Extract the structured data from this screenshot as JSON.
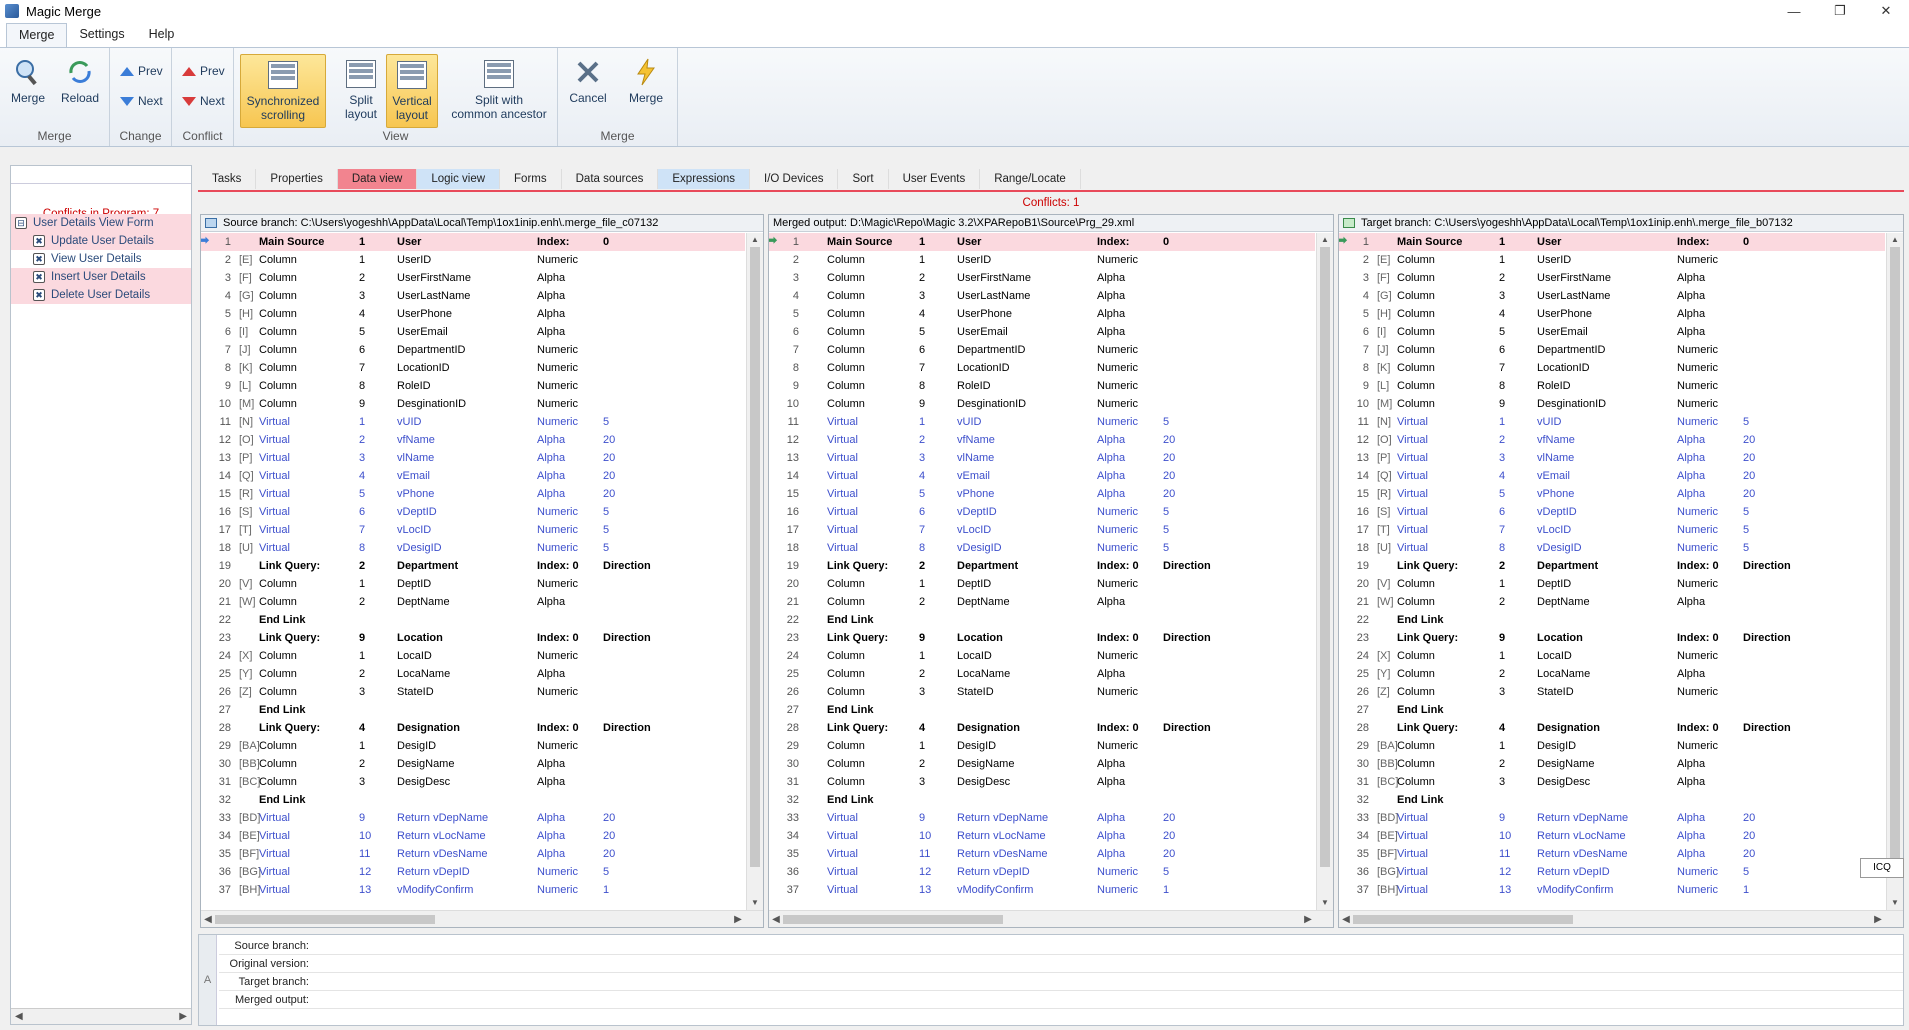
{
  "window": {
    "title": "Magic Merge"
  },
  "menu_tabs": [
    "Merge",
    "Settings",
    "Help"
  ],
  "ribbon": {
    "merge_group": {
      "label": "Merge",
      "merge": "Merge",
      "reload": "Reload"
    },
    "change_group": {
      "label": "Change",
      "prev": "Prev",
      "next": "Next"
    },
    "conflict_group": {
      "label": "Conflict",
      "prev": "Prev",
      "next": "Next"
    },
    "view_group": {
      "label": "View",
      "sync_line1": "Synchronized",
      "sync_line2": "scrolling",
      "split_line1": "Split",
      "split_line2": "layout",
      "vertical_line1": "Vertical",
      "vertical_line2": "layout",
      "ancestor_line1": "Split with",
      "ancestor_line2": "common ancestor"
    },
    "merge2_group": {
      "label": "Merge",
      "cancel": "Cancel",
      "merge": "Merge"
    }
  },
  "left_panel": {
    "conflicts_label": "Conflicts in Program: 7",
    "tree": [
      "User Details View Form",
      "Update User Details",
      "View User Details",
      "Insert User Details",
      "Delete User Details"
    ]
  },
  "tabs": [
    "Tasks",
    "Properties",
    "Data view",
    "Logic view",
    "Forms",
    "Data sources",
    "Expressions",
    "I/O Devices",
    "Sort",
    "User Events",
    "Range/Locate"
  ],
  "conflicts_label": "Conflicts: 1",
  "panes": {
    "source": "Source branch:  C:\\Users\\yogeshh\\AppData\\Local\\Temp\\1ox1inip.enh\\.merge_file_c07132",
    "merged": "Merged output:  D:\\Magic\\Repo\\Magic 3.2\\XPARepoB1\\Source\\Prg_29.xml",
    "target": "Target branch:  C:\\Users\\yogeshh\\AppData\\Local\\Temp\\1ox1inip.enh\\.merge_file_b07132"
  },
  "rows": [
    {
      "n": "1",
      "v": "",
      "t": "Main Source",
      "i": "1",
      "name": "User",
      "type": "Index:",
      "sz": "0",
      "kind": "bold"
    },
    {
      "n": "2",
      "v": "[E]",
      "t": "Column",
      "i": "1",
      "name": "UserID",
      "type": "Numeric",
      "sz": "",
      "kind": "col"
    },
    {
      "n": "3",
      "v": "[F]",
      "t": "Column",
      "i": "2",
      "name": "UserFirstName",
      "type": "Alpha",
      "sz": "",
      "kind": "col"
    },
    {
      "n": "4",
      "v": "[G]",
      "t": "Column",
      "i": "3",
      "name": "UserLastName",
      "type": "Alpha",
      "sz": "",
      "kind": "col"
    },
    {
      "n": "5",
      "v": "[H]",
      "t": "Column",
      "i": "4",
      "name": "UserPhone",
      "type": "Alpha",
      "sz": "",
      "kind": "col"
    },
    {
      "n": "6",
      "v": "[I]",
      "t": "Column",
      "i": "5",
      "name": "UserEmail",
      "type": "Alpha",
      "sz": "",
      "kind": "col"
    },
    {
      "n": "7",
      "v": "[J]",
      "t": "Column",
      "i": "6",
      "name": "DepartmentID",
      "type": "Numeric",
      "sz": "",
      "kind": "col"
    },
    {
      "n": "8",
      "v": "[K]",
      "t": "Column",
      "i": "7",
      "name": "LocationID",
      "type": "Numeric",
      "sz": "",
      "kind": "col"
    },
    {
      "n": "9",
      "v": "[L]",
      "t": "Column",
      "i": "8",
      "name": "RoleID",
      "type": "Numeric",
      "sz": "",
      "kind": "col"
    },
    {
      "n": "10",
      "v": "[M]",
      "t": "Column",
      "i": "9",
      "name": "DesginationID",
      "type": "Numeric",
      "sz": "",
      "kind": "col"
    },
    {
      "n": "11",
      "v": "[N]",
      "t": "Virtual",
      "i": "1",
      "name": "vUID",
      "type": "Numeric",
      "sz": "5",
      "kind": "virt"
    },
    {
      "n": "12",
      "v": "[O]",
      "t": "Virtual",
      "i": "2",
      "name": "vfName",
      "type": "Alpha",
      "sz": "20",
      "kind": "virt"
    },
    {
      "n": "13",
      "v": "[P]",
      "t": "Virtual",
      "i": "3",
      "name": "vlName",
      "type": "Alpha",
      "sz": "20",
      "kind": "virt"
    },
    {
      "n": "14",
      "v": "[Q]",
      "t": "Virtual",
      "i": "4",
      "name": "vEmail",
      "type": "Alpha",
      "sz": "20",
      "kind": "virt"
    },
    {
      "n": "15",
      "v": "[R]",
      "t": "Virtual",
      "i": "5",
      "name": "vPhone",
      "type": "Alpha",
      "sz": "20",
      "kind": "virt"
    },
    {
      "n": "16",
      "v": "[S]",
      "t": "Virtual",
      "i": "6",
      "name": "vDeptID",
      "type": "Numeric",
      "sz": "5",
      "kind": "virt"
    },
    {
      "n": "17",
      "v": "[T]",
      "t": "Virtual",
      "i": "7",
      "name": "vLocID",
      "type": "Numeric",
      "sz": "5",
      "kind": "virt"
    },
    {
      "n": "18",
      "v": "[U]",
      "t": "Virtual",
      "i": "8",
      "name": "vDesigID",
      "type": "Numeric",
      "sz": "5",
      "kind": "virt"
    },
    {
      "n": "19",
      "v": "",
      "t": "Link Query:",
      "i": "2",
      "name": "Department",
      "type": "Index: 0",
      "sz": "Direction",
      "kind": "bold"
    },
    {
      "n": "20",
      "v": "[V]",
      "t": "Column",
      "i": "1",
      "name": "DeptID",
      "type": "Numeric",
      "sz": "",
      "kind": "col"
    },
    {
      "n": "21",
      "v": "[W]",
      "t": "Column",
      "i": "2",
      "name": "DeptName",
      "type": "Alpha",
      "sz": "",
      "kind": "col"
    },
    {
      "n": "22",
      "v": "",
      "t": "End Link",
      "i": "",
      "name": "",
      "type": "",
      "sz": "",
      "kind": "bold"
    },
    {
      "n": "23",
      "v": "",
      "t": "Link Query:",
      "i": "9",
      "name": "Location",
      "type": "Index: 0",
      "sz": "Direction",
      "kind": "bold"
    },
    {
      "n": "24",
      "v": "[X]",
      "t": "Column",
      "i": "1",
      "name": "LocaID",
      "type": "Numeric",
      "sz": "",
      "kind": "col"
    },
    {
      "n": "25",
      "v": "[Y]",
      "t": "Column",
      "i": "2",
      "name": "LocaName",
      "type": "Alpha",
      "sz": "",
      "kind": "col"
    },
    {
      "n": "26",
      "v": "[Z]",
      "t": "Column",
      "i": "3",
      "name": "StateID",
      "type": "Numeric",
      "sz": "",
      "kind": "col"
    },
    {
      "n": "27",
      "v": "",
      "t": "End Link",
      "i": "",
      "name": "",
      "type": "",
      "sz": "",
      "kind": "bold"
    },
    {
      "n": "28",
      "v": "",
      "t": "Link Query:",
      "i": "4",
      "name": "Designation",
      "type": "Index: 0",
      "sz": "Direction",
      "kind": "bold"
    },
    {
      "n": "29",
      "v": "[BA]",
      "t": "Column",
      "i": "1",
      "name": "DesigID",
      "type": "Numeric",
      "sz": "",
      "kind": "col"
    },
    {
      "n": "30",
      "v": "[BB]",
      "t": "Column",
      "i": "2",
      "name": "DesigName",
      "type": "Alpha",
      "sz": "",
      "kind": "col"
    },
    {
      "n": "31",
      "v": "[BC]",
      "t": "Column",
      "i": "3",
      "name": "DesigDesc",
      "type": "Alpha",
      "sz": "",
      "kind": "col"
    },
    {
      "n": "32",
      "v": "",
      "t": "End Link",
      "i": "",
      "name": "",
      "type": "",
      "sz": "",
      "kind": "bold"
    },
    {
      "n": "33",
      "v": "[BD]",
      "t": "Virtual",
      "i": "9",
      "name": "Return vDepName",
      "type": "Alpha",
      "sz": "20",
      "kind": "virt"
    },
    {
      "n": "34",
      "v": "[BE]",
      "t": "Virtual",
      "i": "10",
      "name": "Return vLocName",
      "type": "Alpha",
      "sz": "20",
      "kind": "virt"
    },
    {
      "n": "35",
      "v": "[BF]",
      "t": "Virtual",
      "i": "11",
      "name": "Return vDesName",
      "type": "Alpha",
      "sz": "20",
      "kind": "virt"
    },
    {
      "n": "36",
      "v": "[BG]",
      "t": "Virtual",
      "i": "12",
      "name": "Return vDepID",
      "type": "Numeric",
      "sz": "5",
      "kind": "virt"
    },
    {
      "n": "37",
      "v": "[BH]",
      "t": "Virtual",
      "i": "13",
      "name": "vModifyConfirm",
      "type": "Numeric",
      "sz": "1",
      "kind": "virt"
    }
  ],
  "bottom": {
    "side": "A",
    "labels": [
      "Source branch:",
      "Original version:",
      "Target branch:",
      "Merged output:"
    ]
  },
  "icq": "ICQ"
}
